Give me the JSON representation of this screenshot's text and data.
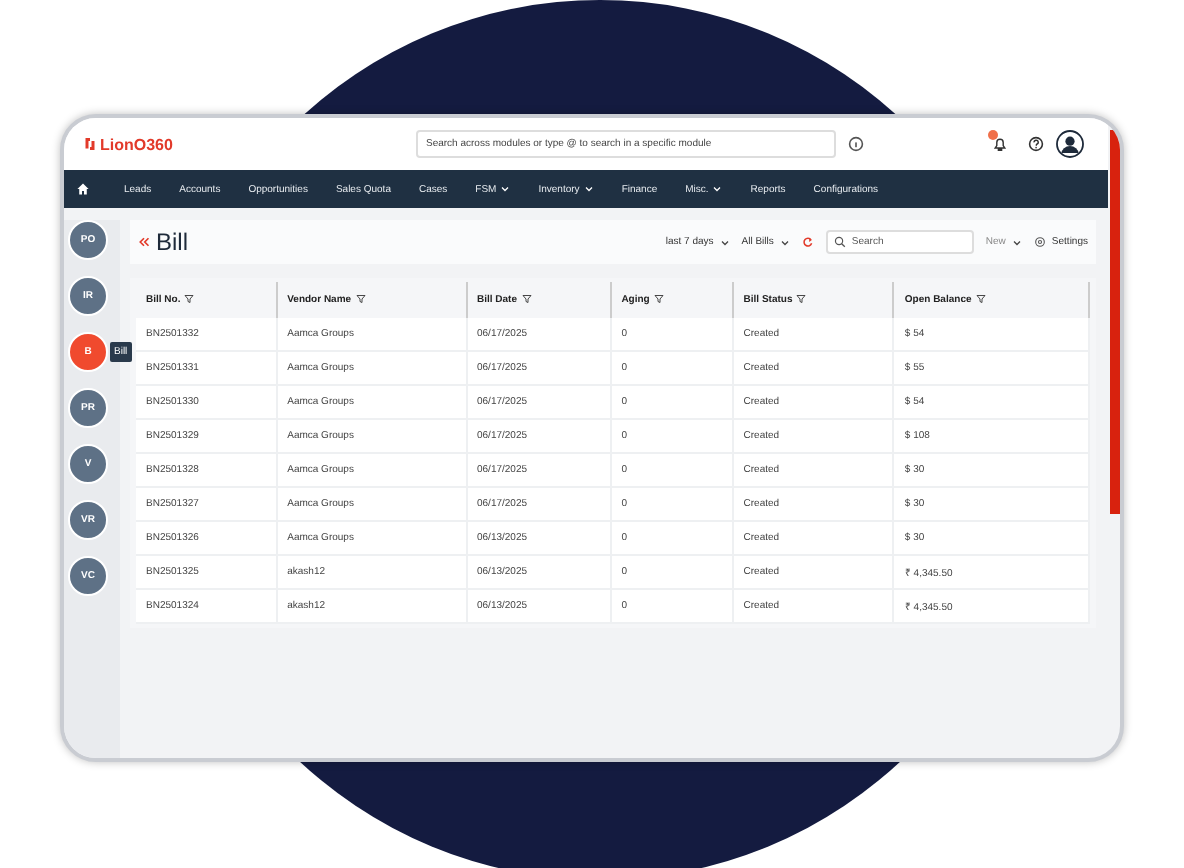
{
  "header": {
    "logo": "LionO360",
    "search": {
      "placeholder": "Search across modules or type @ to search in a specific module"
    },
    "notification_badge": true
  },
  "nav": [
    {
      "label": "Leads",
      "dropdown": false
    },
    {
      "label": "Accounts",
      "dropdown": false
    },
    {
      "label": "Opportunities",
      "dropdown": false
    },
    {
      "label": "Sales Quota",
      "dropdown": false
    },
    {
      "label": "Cases",
      "dropdown": false
    },
    {
      "label": "FSM",
      "dropdown": true
    },
    {
      "label": "Inventory",
      "dropdown": true
    },
    {
      "label": "Finance",
      "dropdown": false
    },
    {
      "label": "Misc.",
      "dropdown": true
    },
    {
      "label": "Reports",
      "dropdown": false
    },
    {
      "label": "Configurations",
      "dropdown": false
    }
  ],
  "sidebar": {
    "items": [
      {
        "label": "PO",
        "selected": false
      },
      {
        "label": "IR",
        "selected": false
      },
      {
        "label": "B",
        "selected": true
      },
      {
        "label": "PR",
        "selected": false
      },
      {
        "label": "V",
        "selected": false
      },
      {
        "label": "VR",
        "selected": false
      },
      {
        "label": "VC",
        "selected": false
      }
    ],
    "tooltip": "Bill"
  },
  "page": {
    "title": "Bill",
    "filters": [
      "last 7 days",
      "All Bills"
    ],
    "search": {
      "placeholder": "Search"
    },
    "new_button": "New",
    "settings": "Settings"
  },
  "table": {
    "columns": [
      "Bill No.",
      "Vendor Name",
      "Bill Date",
      "Aging",
      "Bill Status",
      "Open Balance"
    ],
    "rows": [
      [
        "BN2501332",
        "Aamca Groups",
        "06/17/2025",
        "0",
        "Created",
        "$ 54"
      ],
      [
        "BN2501331",
        "Aamca Groups",
        "06/17/2025",
        "0",
        "Created",
        "$ 55"
      ],
      [
        "BN2501330",
        "Aamca Groups",
        "06/17/2025",
        "0",
        "Created",
        "$ 54"
      ],
      [
        "BN2501329",
        "Aamca Groups",
        "06/17/2025",
        "0",
        "Created",
        "$ 108"
      ],
      [
        "BN2501328",
        "Aamca Groups",
        "06/17/2025",
        "0",
        "Created",
        "$ 30"
      ],
      [
        "BN2501327",
        "Aamca Groups",
        "06/17/2025",
        "0",
        "Created",
        "$ 30"
      ],
      [
        "BN2501326",
        "Aamca Groups",
        "06/13/2025",
        "0",
        "Created",
        "$ 30"
      ],
      [
        "BN2501325",
        "akash12",
        "06/13/2025",
        "0",
        "Created",
        "₹ 4,345.50"
      ],
      [
        "BN2501324",
        "akash12",
        "06/13/2025",
        "0",
        "Created",
        "₹ 4,345.50"
      ]
    ]
  }
}
